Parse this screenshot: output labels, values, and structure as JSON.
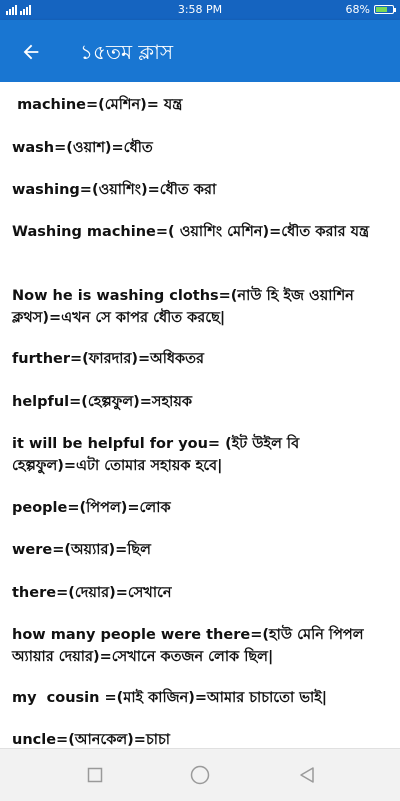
{
  "status_bar": {
    "time": "3:58 PM",
    "battery_percent": "68%",
    "battery_level": 0.68
  },
  "app_bar": {
    "title": "১৫তম ক্লাস",
    "back_icon": "arrow-left-icon"
  },
  "entries": [
    " machine=(মেশিন)= যন্ত্র",
    "wash=(ওয়াশ)=ধৌত",
    "washing=(ওয়াশিং)=ধৌত করা",
    "Washing machine=( ওয়াশিং মেশিন)=ধৌত করার যন্ত্র",
    "Now he is washing cloths=(নাউ হি ইজ ওয়াশিন ক্লথস)=এখন সে কাপর ধৌত করছে|",
    "further=(ফারদার)=অধিকতর",
    "helpful=(হেল্পফুল)=সহায়ক",
    "it will be helpful for you= (ইট উইল বি হেল্পফুল)=এটা তোমার সহায়ক হবে|",
    "people=(পিপল)=লোক",
    "were=(অয়্যার)=ছিল",
    "there=(দেয়ার)=সেখানে",
    "how many people were there=(হাউ মেনি পিপল অ্যায়ার দেয়ার)=সেখানে কতজন লোক ছিল|",
    "my  cousin =(মাই কাজিন)=আমার চাচাতো ভাই|",
    "uncle=(আনকেল)=চাচা"
  ],
  "nav_bar": {
    "icons": [
      "recent-apps-icon",
      "home-icon",
      "back-icon"
    ]
  },
  "colors": {
    "app_bar": "#1976d2",
    "status_bar": "#1564c0",
    "text": "#111111",
    "nav_bar": "#f2f2f2"
  }
}
